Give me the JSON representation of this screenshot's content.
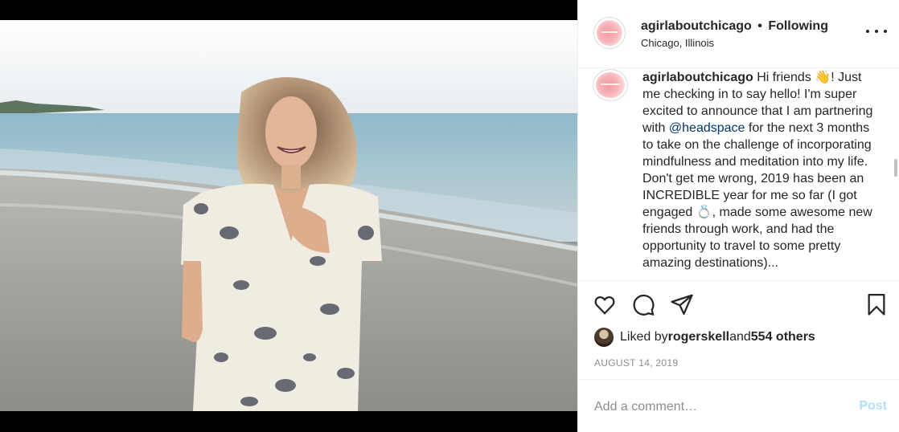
{
  "post": {
    "username": "agirlaboutchicago",
    "separator": "•",
    "follow_status": "Following",
    "location": "Chicago, Illinois",
    "caption_parts": {
      "p1": " Hi friends ",
      "emoji_wave": "👋",
      "p2": "! Just me checking in to say hello! I'm super excited to announce that I am partnering with ",
      "mention": "@headspace",
      "p3": " for the next 3 months to take on the challenge of incorporating mindfulness and meditation into my life. Don't get me wrong, 2019 has been an INCREDIBLE year for me so far (I got engaged ",
      "emoji_ring": "💍",
      "p4": ", made some awesome new friends through work, and had the opportunity to travel to some pretty amazing destinations)..."
    },
    "icons": {
      "like": "heart-icon",
      "comment": "comment-icon",
      "share": "share-icon",
      "save": "bookmark-icon",
      "more": "more-options-icon"
    },
    "likes": {
      "prefix": "Liked by ",
      "user": "rogerskell",
      "middle": " and ",
      "others": "554 others"
    },
    "date": "AUGUST 14, 2019",
    "comment": {
      "placeholder": "Add a comment…",
      "post_label": "Post"
    }
  },
  "colors": {
    "text": "#262626",
    "muted": "#8e8e8e",
    "mention": "#00376b",
    "post_disabled": "#b2dffc",
    "border": "#efefef"
  }
}
